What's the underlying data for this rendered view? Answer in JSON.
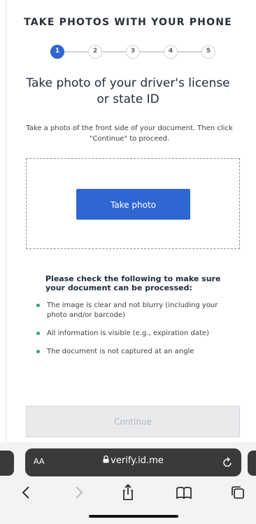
{
  "header": {
    "title": "TAKE PHOTOS WITH YOUR PHONE"
  },
  "stepper": {
    "steps": [
      "1",
      "2",
      "3",
      "4",
      "5"
    ],
    "active_step": 1
  },
  "main": {
    "heading": "Take photo of your driver's license or state ID",
    "instruction": "Take a photo of the front side of your document. Then click \"Continue\" to proceed.",
    "take_photo_label": "Take photo"
  },
  "checklist": {
    "title": "Please check the following to make sure your document can be processed:",
    "items": [
      "The image is clear and not blurry (including your photo and/or barcode)",
      "All information is visible (e.g., expiration date)",
      "The document is not captured at an angle"
    ]
  },
  "footer": {
    "continue_label": "Continue"
  },
  "browser": {
    "text_size_label": "AA",
    "url": "verify.id.me",
    "icons": [
      "lock-icon",
      "reload-icon",
      "back-icon",
      "forward-icon",
      "share-icon",
      "bookmarks-icon",
      "tabs-icon"
    ]
  },
  "colors": {
    "accent": "#2f67d2",
    "bullet": "#36a36a",
    "disabled_button": "#e9eaec"
  }
}
